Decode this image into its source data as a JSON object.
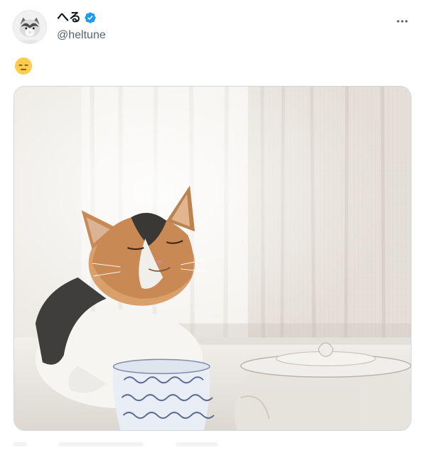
{
  "user": {
    "display_name": "へる",
    "handle": "@heltune",
    "verified": true,
    "verified_color": "#1d9bf0"
  },
  "tweet": {
    "emoji": "expressionless-face"
  },
  "icons": {
    "more": "more-horizontal-icon",
    "verified": "verified-badge-icon"
  },
  "colors": {
    "text_primary": "#0f1419",
    "text_secondary": "#536471",
    "border": "#cfd9de"
  }
}
